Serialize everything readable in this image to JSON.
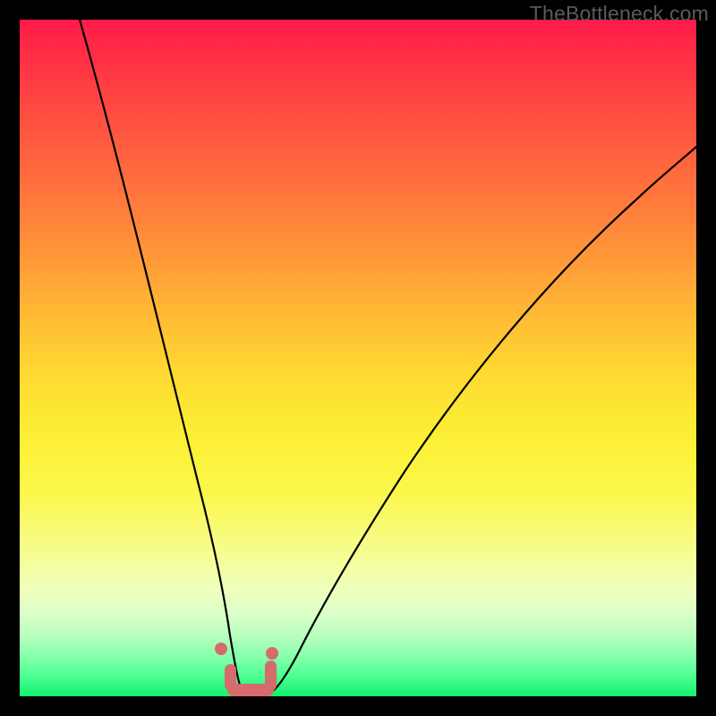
{
  "watermark": "TheBottleneck.com",
  "chart_data": {
    "type": "line",
    "title": "",
    "xlabel": "",
    "ylabel": "",
    "xlim": [
      0,
      100
    ],
    "ylim": [
      0,
      100
    ],
    "grid": false,
    "legend": false,
    "background_gradient": {
      "orientation": "vertical",
      "stops": [
        {
          "pos": 0.0,
          "color": "#ff1a4a"
        },
        {
          "pos": 0.5,
          "color": "#ffd030"
        },
        {
          "pos": 0.8,
          "color": "#f8fb7a"
        },
        {
          "pos": 1.0,
          "color": "#14f06f"
        }
      ]
    },
    "series": [
      {
        "name": "left-curve",
        "x": [
          9,
          12,
          15,
          18,
          21,
          24,
          26,
          28,
          29.5,
          30.5,
          31.2,
          31.8
        ],
        "y": [
          100,
          85,
          70,
          55,
          41,
          28,
          18,
          10,
          5,
          2.5,
          1.2,
          0.6
        ]
      },
      {
        "name": "right-curve",
        "x": [
          37,
          39,
          42,
          46,
          51,
          57,
          64,
          72,
          81,
          90,
          100
        ],
        "y": [
          0.6,
          2.5,
          7,
          14,
          23,
          33,
          44,
          55,
          65,
          74,
          82
        ]
      }
    ],
    "highlight_region": {
      "name": "optimal-valley",
      "x_range": [
        30,
        37
      ],
      "y": 0,
      "color": "#d66a6c"
    },
    "markers": [
      {
        "x": 29.5,
        "y": 5.0,
        "color": "#d66a6c"
      },
      {
        "x": 36.5,
        "y": 4.0,
        "color": "#d66a6c"
      }
    ]
  }
}
